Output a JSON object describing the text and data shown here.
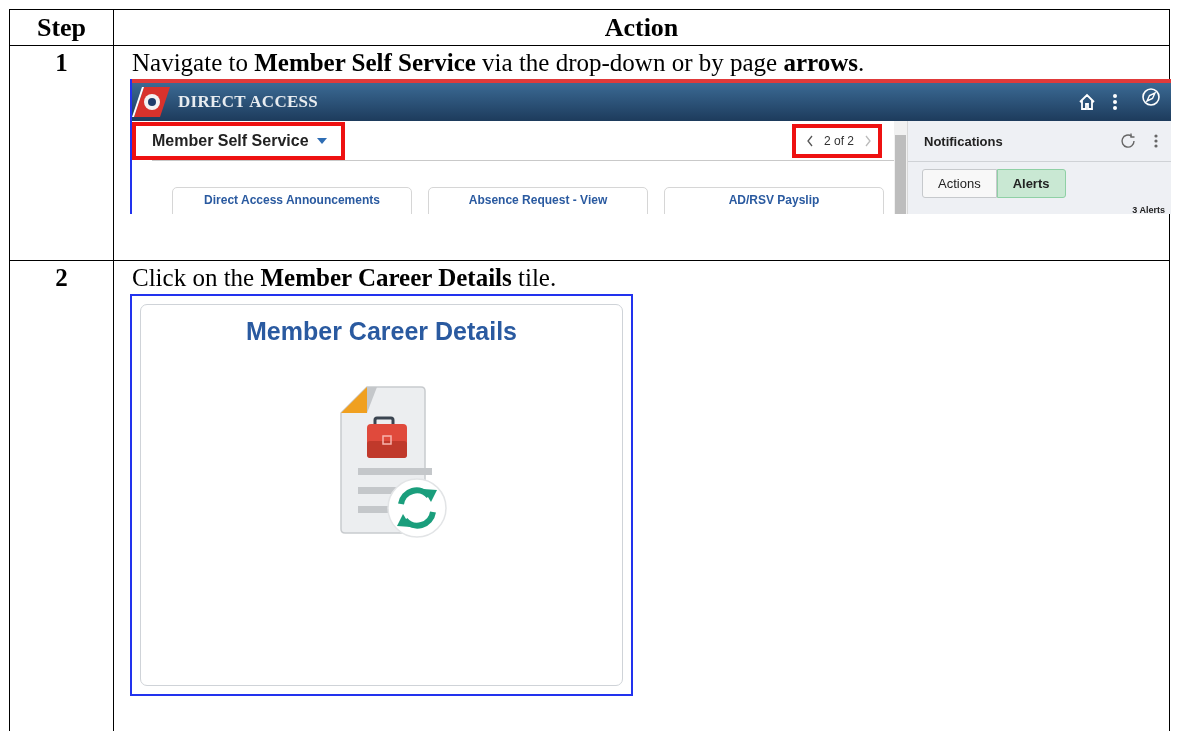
{
  "table": {
    "columns": [
      "Step",
      "Action"
    ],
    "rows": [
      {
        "step": "1",
        "instruction": "Navigate to **Member Self Service** via the drop-down or by page **arrows**.",
        "screenshot": {
          "app_title": "DIRECT ACCESS",
          "homepage": {
            "label": "Member Self Service",
            "highlighted": true
          },
          "pager": {
            "text": "2 of 2",
            "highlighted": true
          },
          "tiles": [
            "Direct Access Announcements",
            "Absence Request - View",
            "AD/RSV Payslip"
          ],
          "notifications": {
            "title": "Notifications",
            "tabs": [
              {
                "label": "Actions",
                "selected": false
              },
              {
                "label": "Alerts",
                "selected": true
              }
            ],
            "count": "3 Alerts"
          }
        }
      },
      {
        "step": "2",
        "instruction": "Click on the **Member Career Details** tile.",
        "tile": {
          "title": "Member Career Details"
        }
      }
    ]
  }
}
